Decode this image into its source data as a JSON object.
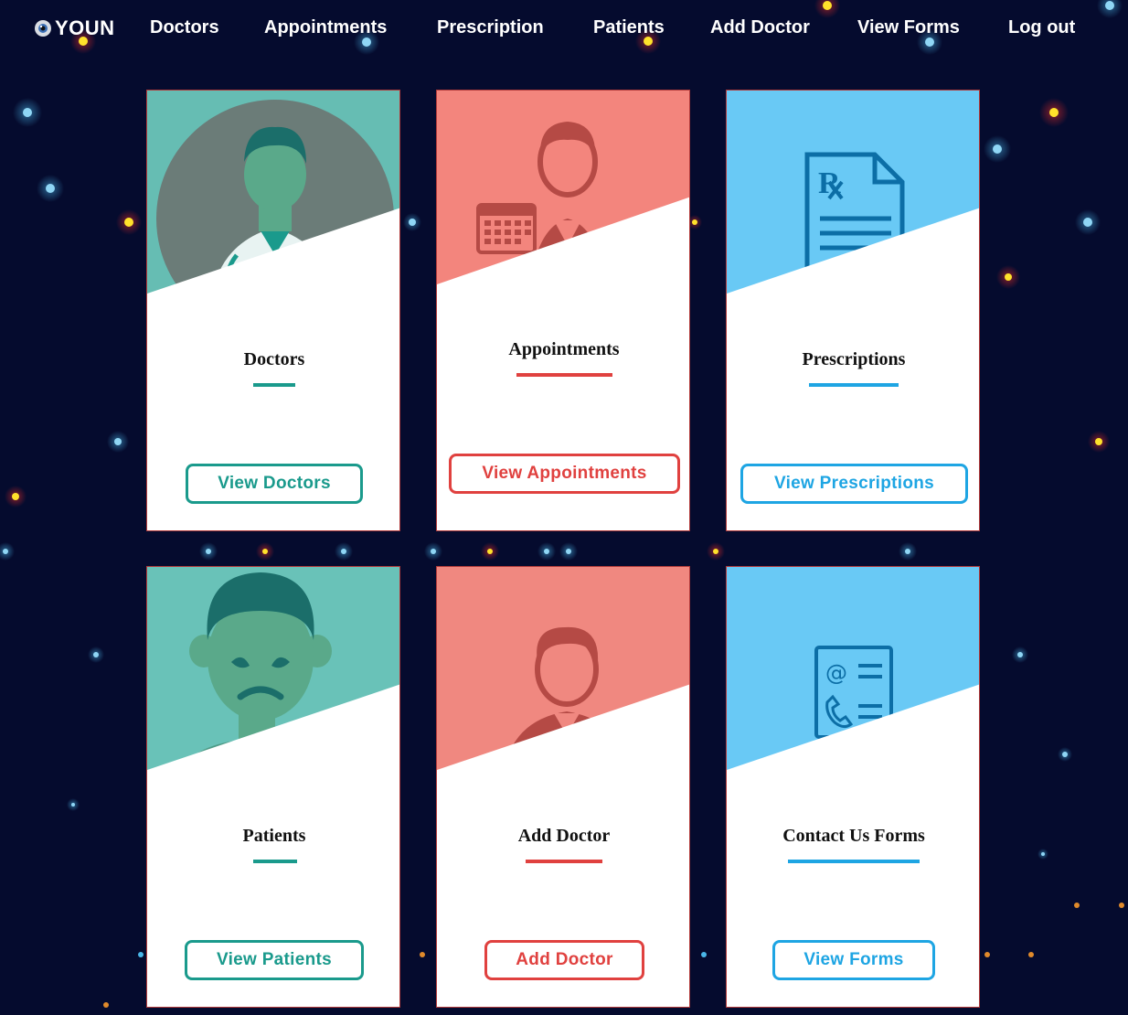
{
  "brand": {
    "name": "YOUN",
    "logo": "eye-logo-icon"
  },
  "nav": {
    "doctors": "Doctors",
    "appointments": "Appointments",
    "prescription": "Prescription",
    "patients": "Patients",
    "add_doctor": "Add Doctor",
    "view_forms": "View Forms",
    "logout": "Log out"
  },
  "colors": {
    "background": "#050b2e",
    "teal": "#1a9a8c",
    "red": "#e0413f",
    "blue": "#1ea5e3"
  },
  "cards": {
    "doctors": {
      "title": "Doctors",
      "button": "View Doctors",
      "icon": "doctor-icon"
    },
    "appointments": {
      "title": "Appointments",
      "button": "View Appointments",
      "icon": "doctor-calendar-icon"
    },
    "prescriptions": {
      "title": "Prescriptions",
      "button": "View Prescriptions",
      "icon": "prescription-icon"
    },
    "patients": {
      "title": "Patients",
      "button": "View Patients",
      "icon": "sick-patient-icon"
    },
    "add_doctor": {
      "title": "Add Doctor",
      "button": "Add Doctor",
      "icon": "doctor-avatar-icon"
    },
    "contact_forms": {
      "title": "Contact Us Forms",
      "button": "View Forms",
      "icon": "contact-form-icon"
    }
  }
}
